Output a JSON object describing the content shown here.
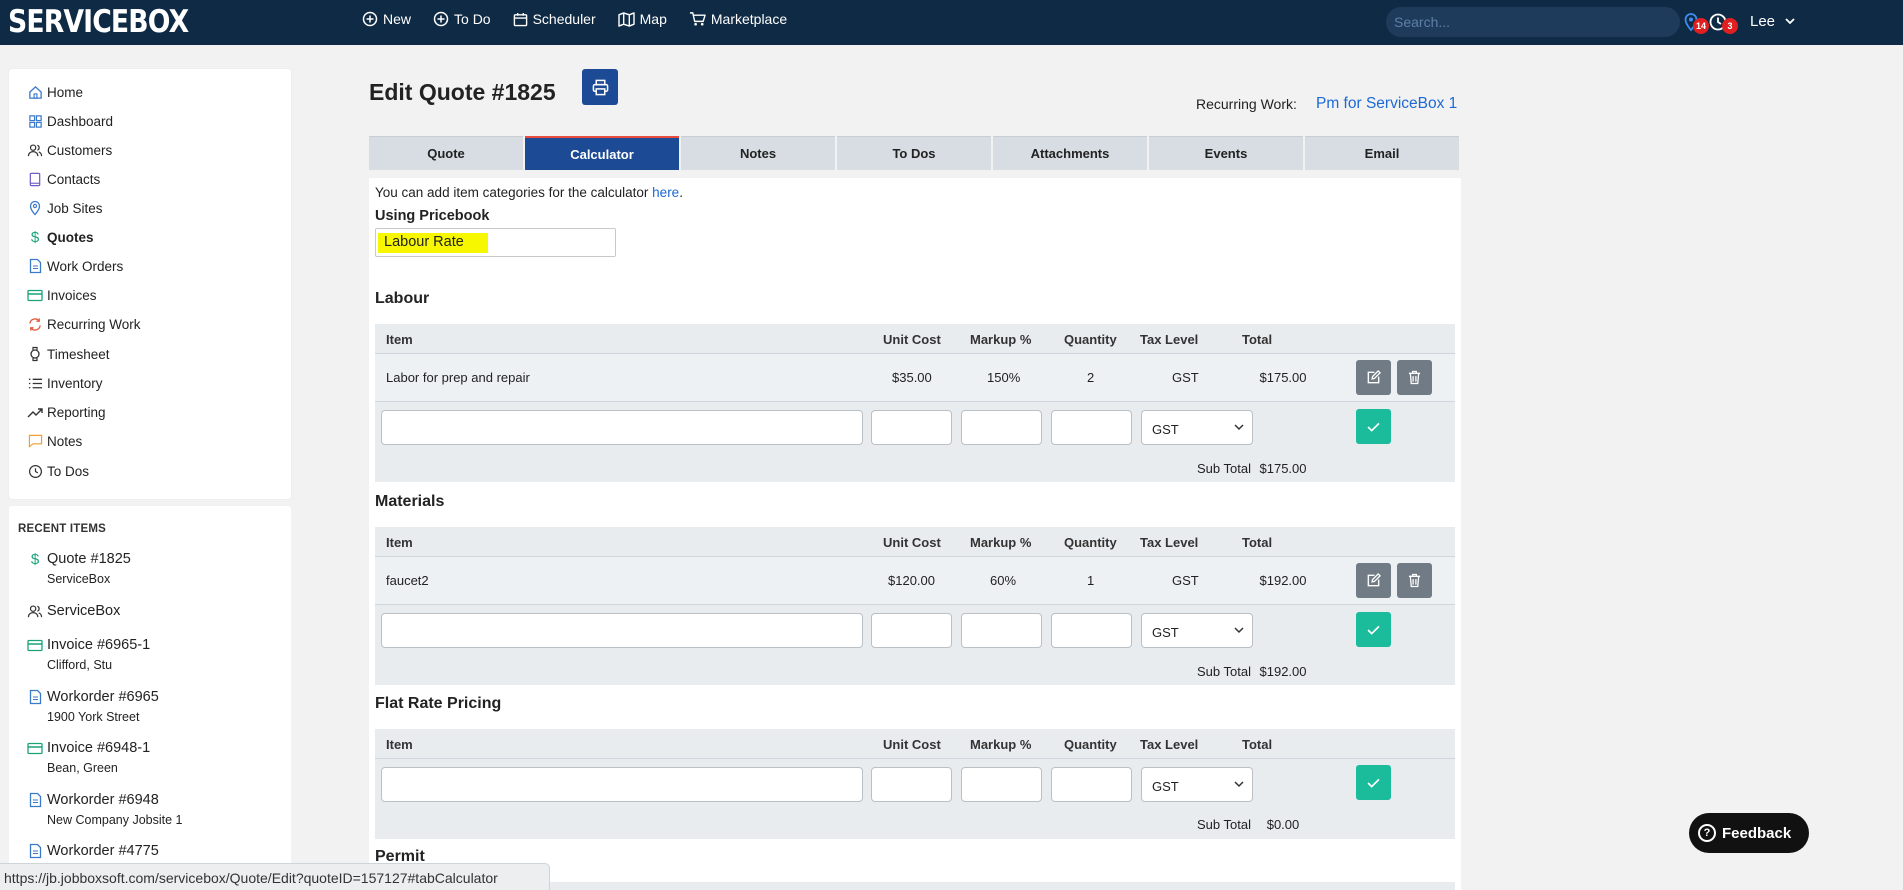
{
  "app": {
    "logo": "SERVICEBOX"
  },
  "topnav": {
    "items": [
      {
        "label": "New",
        "icon": "plus-circle-icon"
      },
      {
        "label": "To Do",
        "icon": "plus-circle-icon"
      },
      {
        "label": "Scheduler",
        "icon": "calendar-icon"
      },
      {
        "label": "Map",
        "icon": "map-icon"
      },
      {
        "label": "Marketplace",
        "icon": "cart-icon"
      }
    ],
    "search_placeholder": "Search...",
    "location_badge": "14",
    "clock_badge": "3",
    "user": "Lee"
  },
  "sidebar": {
    "items": [
      {
        "label": "Home",
        "icon": "home-icon"
      },
      {
        "label": "Dashboard",
        "icon": "dashboard-icon"
      },
      {
        "label": "Customers",
        "icon": "users-icon"
      },
      {
        "label": "Contacts",
        "icon": "book-icon"
      },
      {
        "label": "Job Sites",
        "icon": "location-pin-icon"
      },
      {
        "label": "Quotes",
        "icon": "dollar-icon"
      },
      {
        "label": "Work Orders",
        "icon": "document-icon"
      },
      {
        "label": "Invoices",
        "icon": "credit-card-icon"
      },
      {
        "label": "Recurring Work",
        "icon": "recurring-icon"
      },
      {
        "label": "Timesheet",
        "icon": "watch-icon"
      },
      {
        "label": "Inventory",
        "icon": "list-icon"
      },
      {
        "label": "Reporting",
        "icon": "trend-icon"
      },
      {
        "label": "Notes",
        "icon": "note-icon"
      },
      {
        "label": "To Dos",
        "icon": "clock-icon"
      }
    ],
    "active": "Quotes"
  },
  "recent": {
    "heading": "RECENT ITEMS",
    "items": [
      {
        "title": "Quote #1825",
        "subtitle": "ServiceBox",
        "icon": "dollar-icon"
      },
      {
        "title": "ServiceBox",
        "subtitle": "",
        "icon": "users-icon"
      },
      {
        "title": "Invoice #6965-1",
        "subtitle": "Clifford, Stu",
        "icon": "credit-card-icon"
      },
      {
        "title": "Workorder #6965",
        "subtitle": "1900 York Street",
        "icon": "document-icon"
      },
      {
        "title": "Invoice #6948-1",
        "subtitle": "Bean, Green",
        "icon": "credit-card-icon"
      },
      {
        "title": "Workorder #6948",
        "subtitle": "New Company Jobsite 1",
        "icon": "document-icon"
      },
      {
        "title": "Workorder #4775",
        "subtitle": "",
        "icon": "document-icon"
      }
    ]
  },
  "status_url": "https://jb.jobboxsoft.com/servicebox/Quote/Edit?quoteID=157127#tabCalculator",
  "page": {
    "title": "Edit Quote #1825",
    "recurring_label": "Recurring Work:",
    "recurring_link": "Pm for ServiceBox 1",
    "tabs": [
      "Quote",
      "Calculator",
      "Notes",
      "To Dos",
      "Attachments",
      "Events",
      "Email"
    ],
    "active_tab": "Calculator"
  },
  "calculator": {
    "info_text": "You can add item categories for the calculator ",
    "info_link": "here",
    "info_end": ".",
    "pricebook_label": "Using Pricebook",
    "pricebook_value": "Labour Rate",
    "columns": {
      "item": "Item",
      "unit_cost": "Unit Cost",
      "markup": "Markup %",
      "quantity": "Quantity",
      "tax": "Tax Level",
      "total": "Total"
    },
    "subtotal_label": "Sub Total",
    "default_tax": "GST",
    "sections": [
      {
        "title": "Labour",
        "rows": [
          {
            "item": "Labor for prep and repair",
            "unit_cost": "$35.00",
            "markup": "150%",
            "quantity": "2",
            "tax": "GST",
            "total": "$175.00"
          }
        ],
        "subtotal": "$175.00"
      },
      {
        "title": "Materials",
        "rows": [
          {
            "item": "faucet2",
            "unit_cost": "$120.00",
            "markup": "60%",
            "quantity": "1",
            "tax": "GST",
            "total": "$192.00"
          }
        ],
        "subtotal": "$192.00"
      },
      {
        "title": "Flat Rate Pricing",
        "rows": [],
        "subtotal": "$0.00"
      },
      {
        "title": "Permit",
        "rows": [],
        "subtotal": ""
      }
    ]
  },
  "feedback_label": "Feedback",
  "colors": {
    "topbar": "#0f2a44",
    "primary": "#1c4a94",
    "accent_green": "#1abc9c",
    "link": "#1c6ad4",
    "highlight": "#f7f700"
  }
}
